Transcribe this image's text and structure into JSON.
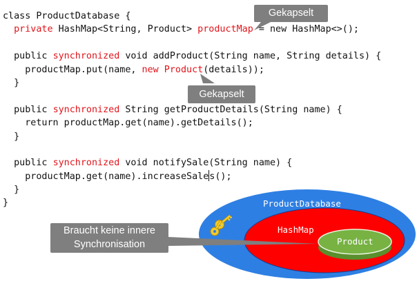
{
  "code": [
    {
      "segs": [
        {
          "t": "class ProductDatabase {",
          "kw": false
        }
      ]
    },
    {
      "segs": [
        {
          "t": "  ",
          "kw": false
        },
        {
          "t": "private",
          "kw": true
        },
        {
          "t": " HashMap<String, Product> ",
          "kw": false
        },
        {
          "t": "productMap",
          "kw": true
        },
        {
          "t": " = new HashMap<>();",
          "kw": false
        }
      ]
    },
    {
      "segs": []
    },
    {
      "segs": [
        {
          "t": "  public ",
          "kw": false
        },
        {
          "t": "synchronized",
          "kw": true
        },
        {
          "t": " void addProduct(String name, String details) {",
          "kw": false
        }
      ]
    },
    {
      "segs": [
        {
          "t": "    productMap.put(name, ",
          "kw": false
        },
        {
          "t": "new Product",
          "kw": true
        },
        {
          "t": "(details));",
          "kw": false
        }
      ]
    },
    {
      "segs": [
        {
          "t": "  }",
          "kw": false
        }
      ]
    },
    {
      "segs": []
    },
    {
      "segs": [
        {
          "t": "  public ",
          "kw": false
        },
        {
          "t": "synchronized",
          "kw": true
        },
        {
          "t": " String getProductDetails(String name) {",
          "kw": false
        }
      ]
    },
    {
      "segs": [
        {
          "t": "    return productMap.get(name).getDetails();",
          "kw": false
        }
      ]
    },
    {
      "segs": [
        {
          "t": "  }",
          "kw": false
        }
      ]
    },
    {
      "segs": []
    },
    {
      "segs": [
        {
          "t": "  public ",
          "kw": false
        },
        {
          "t": "synchronized",
          "kw": true
        },
        {
          "t": " void notifySale(String name) {",
          "kw": false
        }
      ]
    },
    {
      "segs": [
        {
          "t": "    productMap.get(name).increaseSale",
          "kw": false
        },
        {
          "t": "|",
          "kw": false,
          "cursor": true
        },
        {
          "t": "s();",
          "kw": false
        }
      ]
    },
    {
      "segs": [
        {
          "t": "  }",
          "kw": false
        }
      ]
    },
    {
      "segs": [
        {
          "t": "}",
          "kw": false
        }
      ]
    }
  ],
  "callouts": {
    "encapsulated_top": "Gekapselt",
    "encapsulated_mid": "Gekapselt",
    "no_sync": [
      "Braucht keine innere",
      "Synchronisation"
    ]
  },
  "diagram": {
    "outer_label": "ProductDatabase",
    "middle_label": "HashMap",
    "inner_label": "Product",
    "colors": {
      "outer": "#2e7fe3",
      "middle": "#ff0000",
      "inner": "#77b243",
      "callout": "#7f7f7f",
      "keyword": "#e0151b",
      "key": "#f2cc2b"
    },
    "icon": "key-icon"
  }
}
